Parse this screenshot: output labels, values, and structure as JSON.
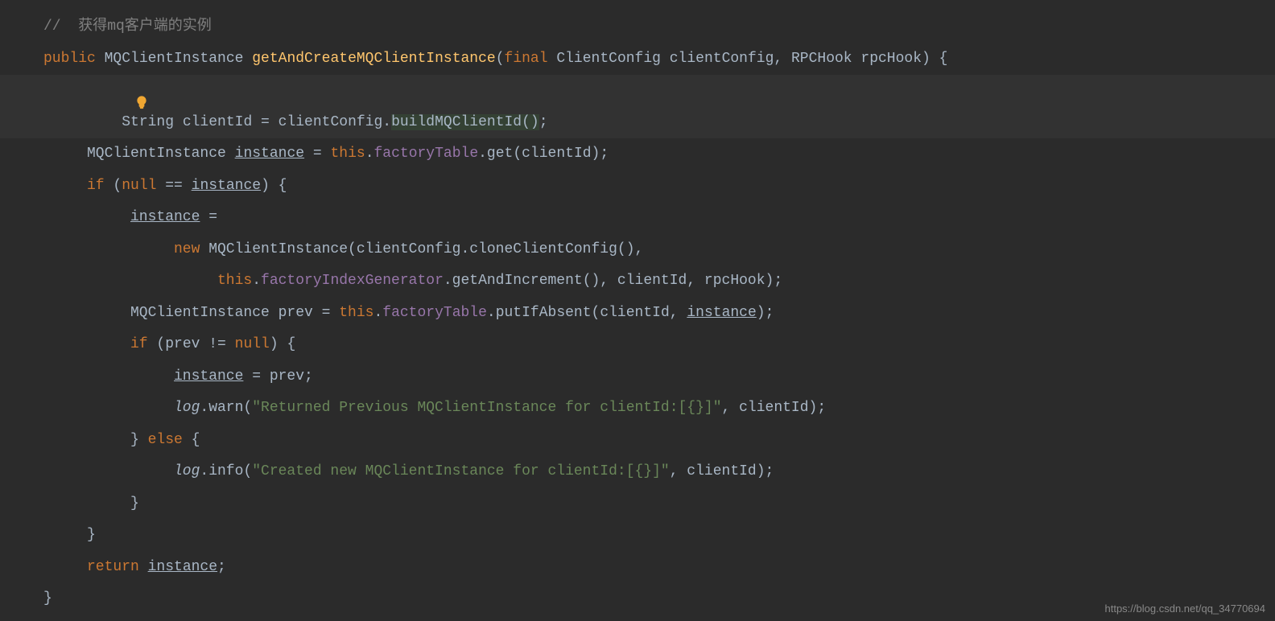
{
  "code": {
    "line1": {
      "comment": "//  获得mq客户端的实例"
    },
    "line2": {
      "public": "public",
      "type1": " MQClientInstance ",
      "method": "getAndCreateMQClientInstance",
      "paren_open": "(",
      "final": "final",
      "type2": " ClientConfig clientConfig, RPCHook rpcHook) {"
    },
    "line3": {
      "text1": "String clientId = clientConfig.",
      "highlight": "buildMQClientId()",
      "text2": ";"
    },
    "line4": {
      "text1": "MQClientInstance ",
      "instance": "instance",
      "text2": " = ",
      "this": "this",
      "dot": ".",
      "field": "factoryTable",
      "text3": ".get(clientId);"
    },
    "line5": {
      "if": "if",
      "text1": " (",
      "null": "null",
      "text2": " == ",
      "instance": "instance",
      "text3": ") {"
    },
    "line6": {
      "instance": "instance",
      "text1": " ="
    },
    "line7": {
      "new": "new",
      "text1": " MQClientInstance(clientConfig.cloneClientConfig(),"
    },
    "line8": {
      "this": "this",
      "dot": ".",
      "field": "factoryIndexGenerator",
      "text1": ".getAndIncrement(), clientId, rpcHook);"
    },
    "line9": {
      "text1": "MQClientInstance prev = ",
      "this": "this",
      "dot": ".",
      "field": "factoryTable",
      "text2": ".putIfAbsent(clientId, ",
      "instance": "instance",
      "text3": ");"
    },
    "line10": {
      "if": "if",
      "text1": " (prev != ",
      "null": "null",
      "text2": ") {"
    },
    "line11": {
      "instance": "instance",
      "text1": " = prev;"
    },
    "line12": {
      "log": "log",
      "text1": ".warn(",
      "string": "\"Returned Previous MQClientInstance for clientId:[{}]\"",
      "text2": ", clientId);"
    },
    "line13": {
      "text1": "} ",
      "else": "else",
      "text2": " {"
    },
    "line14": {
      "log": "log",
      "text1": ".info(",
      "string": "\"Created new MQClientInstance for clientId:[{}]\"",
      "text2": ", clientId);"
    },
    "line15": {
      "text1": "}"
    },
    "line16": {
      "text1": "}"
    },
    "line17": {
      "text1": ""
    },
    "line18": {
      "return": "return",
      "text1": " ",
      "instance": "instance",
      "text2": ";"
    },
    "line19": {
      "text1": "}"
    }
  },
  "watermark": "https://blog.csdn.net/qq_34770694"
}
